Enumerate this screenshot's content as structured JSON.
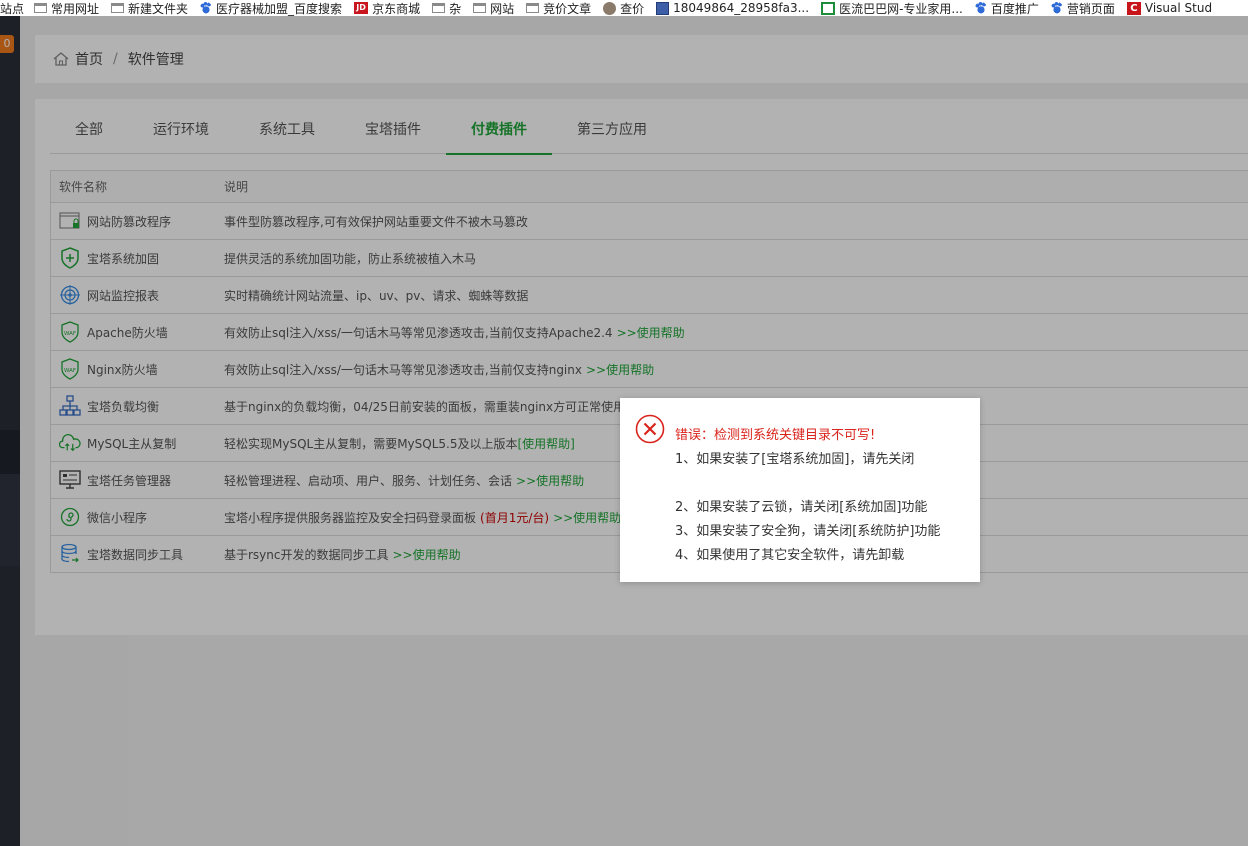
{
  "bookmarks": [
    {
      "label": "站点",
      "icon": "none"
    },
    {
      "label": "常用网址",
      "icon": "folder"
    },
    {
      "label": "新建文件夹",
      "icon": "folder"
    },
    {
      "label": "医疗器械加盟_百度搜索",
      "icon": "baidu-paw"
    },
    {
      "label": "京东商城",
      "icon": "jd"
    },
    {
      "label": "杂",
      "icon": "folder"
    },
    {
      "label": "网站",
      "icon": "folder"
    },
    {
      "label": "竞价文章",
      "icon": "folder"
    },
    {
      "label": "查价",
      "icon": "coin"
    },
    {
      "label": "18049864_28958fa3...",
      "icon": "image-box"
    },
    {
      "label": "医流巴巴网-专业家用...",
      "icon": "house"
    },
    {
      "label": "百度推广",
      "icon": "baidu-paw"
    },
    {
      "label": "营销页面",
      "icon": "baidu-paw"
    },
    {
      "label": "Visual Stud",
      "icon": "c-logo"
    }
  ],
  "sidebar": {
    "badge": "0"
  },
  "breadcrumb": {
    "home": "首页",
    "separator": "/",
    "current": "软件管理"
  },
  "tabs": [
    {
      "label": "全部",
      "active": false
    },
    {
      "label": "运行环境",
      "active": false
    },
    {
      "label": "系统工具",
      "active": false
    },
    {
      "label": "宝塔插件",
      "active": false
    },
    {
      "label": "付费插件",
      "active": true
    },
    {
      "label": "第三方应用",
      "active": false
    }
  ],
  "table": {
    "headers": {
      "name": "软件名称",
      "desc": "说明"
    },
    "rows": [
      {
        "name": "网站防篡改程序",
        "icon": "web-lock-icon",
        "desc": "事件型防篡改程序,可有效保护网站重要文件不被木马篡改",
        "help": "",
        "price": ""
      },
      {
        "name": "宝塔系统加固",
        "icon": "shield-icon",
        "desc": "提供灵活的系统加固功能，防止系统被植入木马",
        "help": "",
        "price": ""
      },
      {
        "name": "网站监控报表",
        "icon": "target-icon",
        "desc": "实时精确统计网站流量、ip、uv、pv、请求、蜘蛛等数据",
        "help": "",
        "price": ""
      },
      {
        "name": "Apache防火墙",
        "icon": "waf-icon",
        "desc": "有效防止sql注入/xss/一句话木马等常见渗透攻击,当前仅支持Apache2.4",
        "help": ">>使用帮助",
        "price": ""
      },
      {
        "name": "Nginx防火墙",
        "icon": "waf-icon",
        "desc": "有效防止sql注入/xss/一句话木马等常见渗透攻击,当前仅支持nginx",
        "help": ">>使用帮助",
        "price": ""
      },
      {
        "name": "宝塔负载均衡",
        "icon": "network-icon",
        "desc": "基于nginx的负载均衡，04/25日前安装的面板，需重装nginx方可正常使用",
        "help": "",
        "price": ""
      },
      {
        "name": "MySQL主从复制",
        "icon": "cloud-sync-icon",
        "desc": "轻松实现MySQL主从复制，需要MySQL5.5及以上版本",
        "help": "[使用帮助]",
        "price": ""
      },
      {
        "name": "宝塔任务管理器",
        "icon": "monitor-icon",
        "desc": "轻松管理进程、启动项、用户、服务、计划任务、会话",
        "help": ">>使用帮助",
        "price": ""
      },
      {
        "name": "微信小程序",
        "icon": "wechat-mini-icon",
        "desc": "宝塔小程序提供服务器监控及安全扫码登录面板",
        "help": ">>使用帮助",
        "price": "(首月1元/台)"
      },
      {
        "name": "宝塔数据同步工具",
        "icon": "database-sync-icon",
        "desc": "基于rsync开发的数据同步工具",
        "help": ">>使用帮助",
        "price": ""
      }
    ]
  },
  "dialog": {
    "title": "错误：检测到系统关键目录不可写!",
    "lines": [
      "1、如果安装了[宝塔系统加固]，请先关闭",
      "2、如果安装了云锁，请关闭[系统加固]功能",
      "3、如果安装了安全狗，请关闭[系统防护]功能",
      "4、如果使用了其它安全软件，请先卸载"
    ]
  },
  "colors": {
    "accent": "#20a53a",
    "error": "#d9241c",
    "sidebar": "#2b2f3a",
    "badge": "#f37b1d"
  }
}
